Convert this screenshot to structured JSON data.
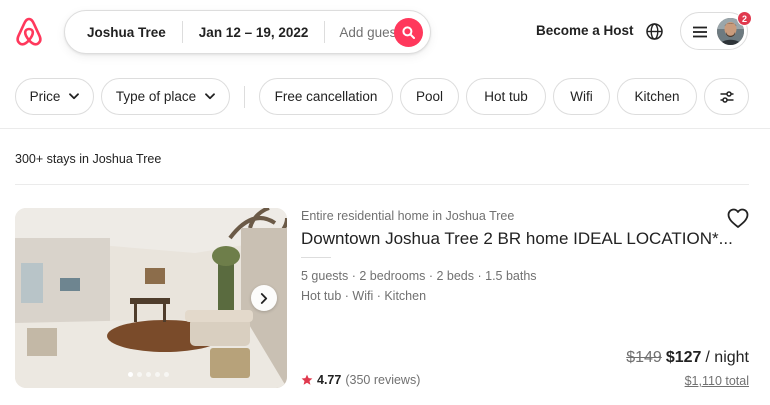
{
  "colors": {
    "brand": "#ff385c",
    "text": "#222222",
    "muted": "#717171",
    "border": "#dddddd",
    "badge": "#e0394e",
    "star": "#e0394e"
  },
  "header": {
    "logo_icon": "airbnb-logo-icon",
    "search": {
      "location": "Joshua Tree",
      "dates": "Jan 12 – 19, 2022",
      "guests_placeholder": "Add guests",
      "button_icon": "search-icon"
    },
    "become_host": "Become a Host",
    "globe_icon": "globe-icon",
    "menu": {
      "menu_icon": "hamburger-icon",
      "avatar": "user-avatar",
      "notification_count": "2"
    }
  },
  "filters": {
    "items": [
      {
        "label": "Price",
        "has_dropdown": true
      },
      {
        "label": "Type of place",
        "has_dropdown": true
      },
      {
        "label": "Free cancellation"
      },
      {
        "label": "Pool"
      },
      {
        "label": "Hot tub"
      },
      {
        "label": "Wifi"
      },
      {
        "label": "Kitchen"
      }
    ],
    "more_filters_icon": "sliders-icon"
  },
  "results": {
    "count_text": "300+ stays in Joshua Tree"
  },
  "listing": {
    "subtitle": "Entire residential home in Joshua Tree",
    "title": "Downtown Joshua Tree 2 BR home IDEAL LOCATION*...",
    "details": "5 guests · 2 bedrooms · 2 beds · 1.5 baths",
    "amenities": "Hot tub · Wifi · Kitchen",
    "rating": "4.77",
    "reviews": "(350 reviews)",
    "price_old": "$149",
    "price_now": "$127",
    "price_unit": "/ night",
    "total": "$1,110 total",
    "photo_count": 5,
    "active_photo": 1
  }
}
